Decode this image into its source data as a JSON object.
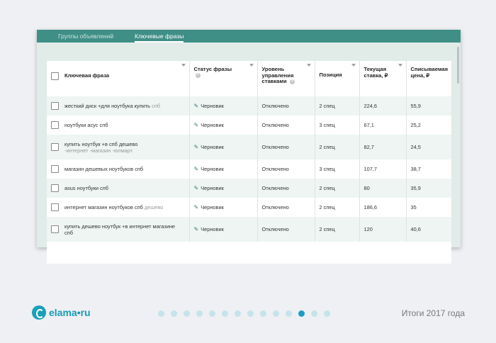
{
  "tabs": [
    {
      "label": "Группы объявлений",
      "active": false
    },
    {
      "label": "Ключевые фразы",
      "active": true
    }
  ],
  "table": {
    "headers": {
      "keyword": "Ключевая фраза",
      "status": "Статус фразы",
      "bid_level": "Уровень управления ставками",
      "position": "Позиция",
      "current_bid": "Текущая ставка, ₽",
      "charged_price": "Списываемая цена, ₽"
    },
    "rows": [
      {
        "keyword": "жесткий диск +для ноутбука купить",
        "keyword_muted": "спб",
        "status": "Черновик",
        "bid_level": "Отключено",
        "position": "2 спец",
        "current_bid": "224,6",
        "charged_price": "55,9"
      },
      {
        "keyword": "ноутбуки асус спб",
        "keyword_muted": "",
        "status": "Черновик",
        "bid_level": "Отключено",
        "position": "3 спец",
        "current_bid": "67,1",
        "charged_price": "25,2"
      },
      {
        "keyword": "купить ноутбук +в спб дешево",
        "keyword_muted": "-интернет -магазин -юлмарт",
        "status": "Черновик",
        "bid_level": "Отключено",
        "position": "2 спец",
        "current_bid": "82,7",
        "charged_price": "24,5"
      },
      {
        "keyword": "магазин дешевых ноутбуков спб",
        "keyword_muted": "",
        "status": "Черновик",
        "bid_level": "Отключено",
        "position": "3 спец",
        "current_bid": "107,7",
        "charged_price": "38,7"
      },
      {
        "keyword": "asus ноутбуки спб",
        "keyword_muted": "",
        "status": "Черновик",
        "bid_level": "Отключено",
        "position": "2 спец",
        "current_bid": "80",
        "charged_price": "35,9"
      },
      {
        "keyword": "интернет магазин ноутбуков спб",
        "keyword_muted": "дешево",
        "status": "Черновик",
        "bid_level": "Отключено",
        "position": "2 спец",
        "current_bid": "186,6",
        "charged_price": "35"
      },
      {
        "keyword": "купить дешево ноутбук +в интернет магазине спб",
        "keyword_muted": "",
        "status": "Черновик",
        "bid_level": "Отключено",
        "position": "2 спец",
        "current_bid": "120",
        "charged_price": "40,6"
      }
    ]
  },
  "footer": {
    "logo_text": "elama•ru",
    "title": "Итоги 2017 года",
    "dots_count": 14,
    "active_dot": 11
  },
  "colors": {
    "tab_bar": "#3f8f87",
    "accent": "#1b9fc1"
  }
}
